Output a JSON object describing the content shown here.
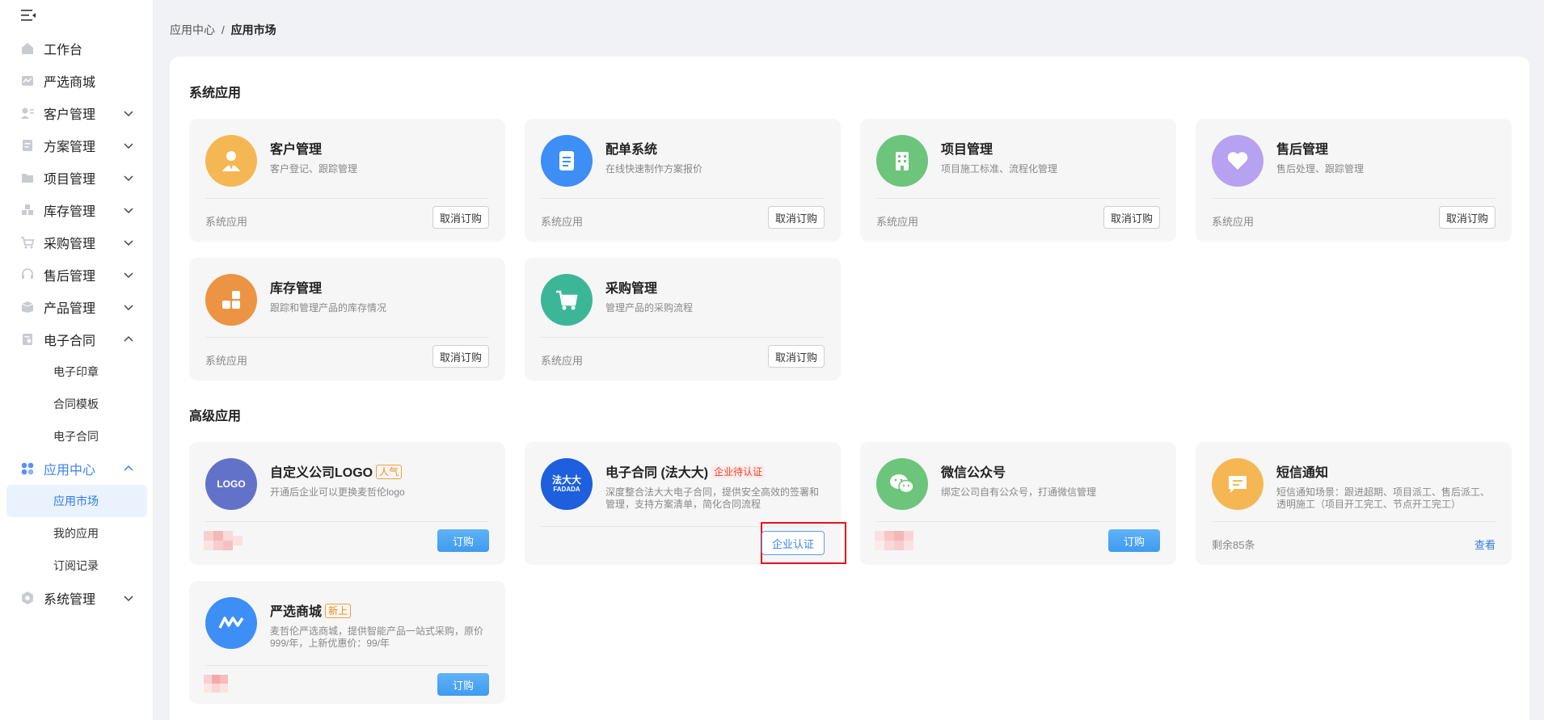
{
  "sidebar": {
    "items": [
      {
        "label": "工作台",
        "icon": "home-icon",
        "expandable": false
      },
      {
        "label": "严选商城",
        "icon": "mall-icon",
        "expandable": false
      },
      {
        "label": "客户管理",
        "icon": "customer-icon",
        "expandable": true
      },
      {
        "label": "方案管理",
        "icon": "plan-icon",
        "expandable": true
      },
      {
        "label": "项目管理",
        "icon": "folder-icon",
        "expandable": true
      },
      {
        "label": "库存管理",
        "icon": "inventory-icon",
        "expandable": true
      },
      {
        "label": "采购管理",
        "icon": "cart-icon",
        "expandable": true
      },
      {
        "label": "售后管理",
        "icon": "headset-icon",
        "expandable": true
      },
      {
        "label": "产品管理",
        "icon": "box-icon",
        "expandable": true
      },
      {
        "label": "电子合同",
        "icon": "contract-icon",
        "expandable": true,
        "expanded": true
      }
    ],
    "contract_sub": [
      "电子印章",
      "合同模板",
      "电子合同"
    ],
    "app_center": {
      "label": "应用中心",
      "icon": "apps-icon"
    },
    "app_center_sub": [
      "应用市场",
      "我的应用",
      "订阅记录"
    ],
    "system": {
      "label": "系统管理",
      "icon": "gear-icon"
    }
  },
  "breadcrumb": {
    "parent": "应用中心",
    "separator": "/",
    "current": "应用市场"
  },
  "sections": {
    "system_title": "系统应用",
    "advanced_title": "高级应用"
  },
  "system_apps": [
    {
      "name": "客户管理",
      "desc": "客户登记、跟踪管理",
      "label": "系统应用",
      "action": "取消订购",
      "icon": "person-icon",
      "color": "#f5b754"
    },
    {
      "name": "配单系统",
      "desc": "在线快速制作方案报价",
      "label": "系统应用",
      "action": "取消订购",
      "icon": "document-icon",
      "color": "#3d8ef5"
    },
    {
      "name": "项目管理",
      "desc": "项目施工标准、流程化管理",
      "label": "系统应用",
      "action": "取消订购",
      "icon": "building-icon",
      "color": "#6cc57a"
    },
    {
      "name": "售后管理",
      "desc": "售后处理、跟踪管理",
      "label": "系统应用",
      "action": "取消订购",
      "icon": "heart-icon",
      "color": "#b6a2f0"
    },
    {
      "name": "库存管理",
      "desc": "跟踪和管理产品的库存情况",
      "label": "系统应用",
      "action": "取消订购",
      "icon": "blocks-icon",
      "color": "#ec9443"
    },
    {
      "name": "采购管理",
      "desc": "管理产品的采购流程",
      "label": "系统应用",
      "action": "取消订购",
      "icon": "cart-icon",
      "color": "#3bb797"
    }
  ],
  "advanced_apps": [
    {
      "name": "自定义公司LOGO",
      "tag": "人气",
      "desc": "开通后企业可以更换麦哲伦logo",
      "action": "订购",
      "logo_text": "LOGO",
      "color": "#6372c9"
    },
    {
      "name": "电子合同 (法大大)",
      "tag": "企业待认证",
      "desc": "深度整合法大大电子合同，提供安全高效的签署和管理，支持方案清单，简化合同流程",
      "action": "企业认证",
      "logo_text": "法大大",
      "logo_sub": "FADADA",
      "color": "#1d5fdc"
    },
    {
      "name": "微信公众号",
      "desc": "绑定公司自有公众号，打通微信管理",
      "action": "订购",
      "icon": "wechat-icon",
      "color": "#6cc57a"
    },
    {
      "name": "短信通知",
      "desc": "短信通知场景：跟进超期、项目派工、售后派工、透明施工（项目开工完工、节点开工完工）",
      "remain": "剩余85条",
      "action": "查看",
      "icon": "message-icon",
      "color": "#f5b754"
    },
    {
      "name": "严选商城",
      "tag": "新上",
      "desc": "麦哲伦严选商城，提供智能产品一站式采购，原价999/年，上新优惠价：99/年",
      "action": "订购",
      "icon": "mall-logo-icon",
      "color": "#3d8ef5"
    }
  ]
}
